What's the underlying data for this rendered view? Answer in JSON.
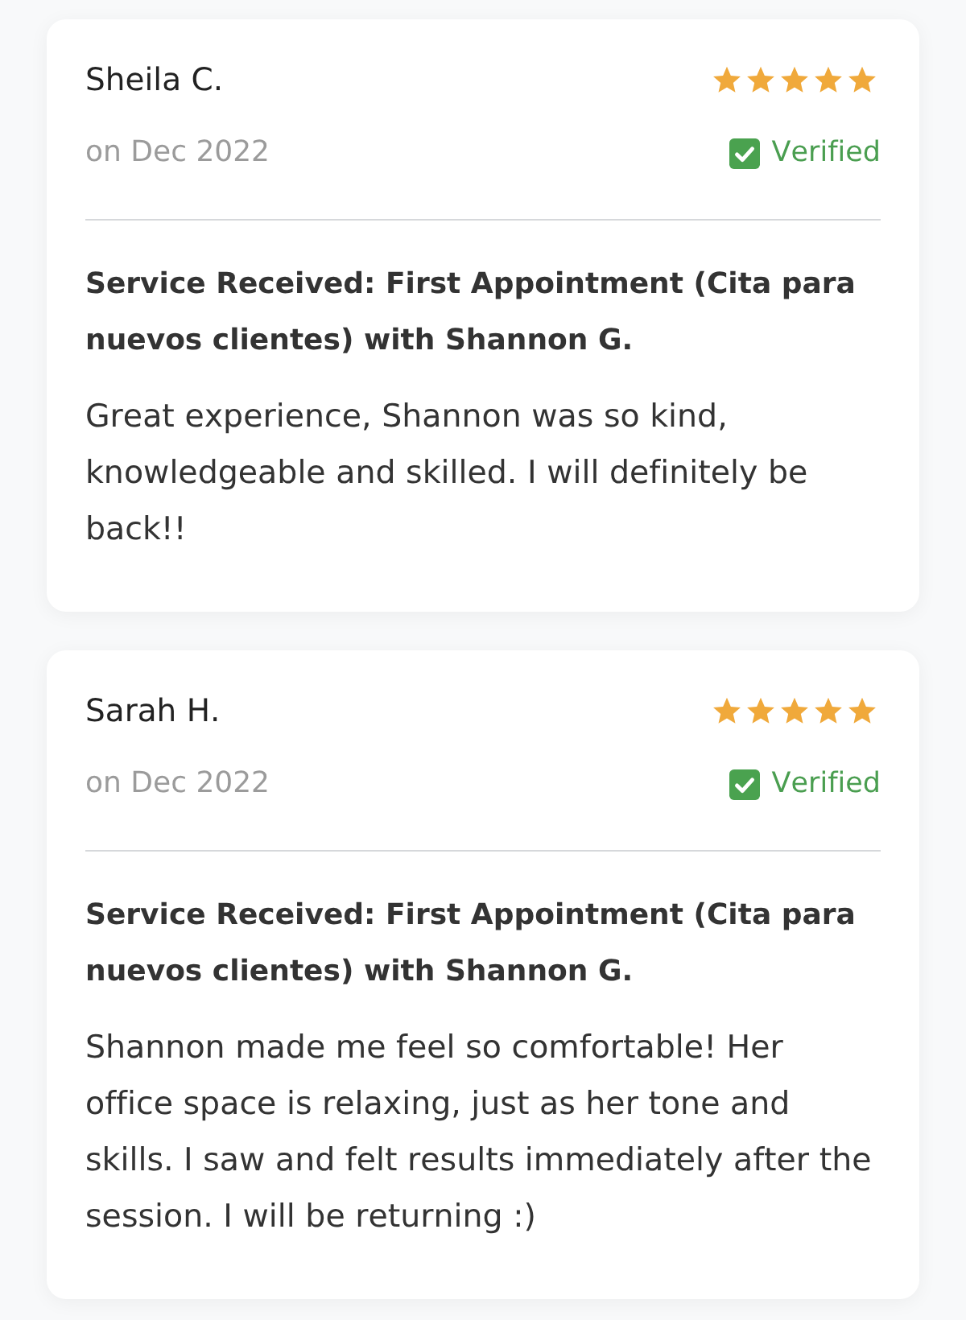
{
  "reviews": [
    {
      "name": "Sheila C.",
      "stars": 5,
      "date": "on Dec 2022",
      "verified": true,
      "verified_label": "Verified",
      "service": "Service Received: First Appointment (Cita para nuevos clientes) with Shannon G.",
      "text": "Great experience, Shannon was so kind, knowledgeable and skilled. I will definitely be back!!"
    },
    {
      "name": "Sarah H.",
      "stars": 5,
      "date": "on Dec 2022",
      "verified": true,
      "verified_label": "Verified",
      "service": "Service Received: First Appointment (Cita para nuevos clientes) with Shannon G.",
      "text": "Shannon made me feel so comfortable! Her office space is relaxing, just as her tone and skills. I saw and felt results immediately after the session. I will be returning :)"
    }
  ]
}
